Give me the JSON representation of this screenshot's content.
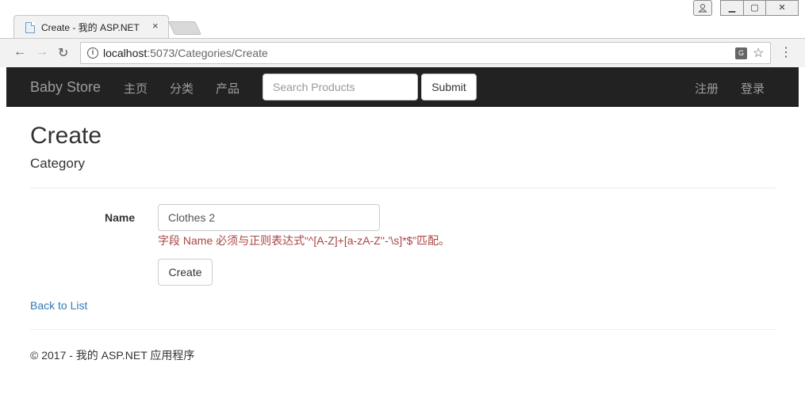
{
  "browser": {
    "tab_title": "Create - 我的 ASP.NET",
    "tab_close": "×",
    "url_host": "localhost",
    "url_path": ":5073/Categories/Create",
    "window_user_icon": "user-icon",
    "window_controls": {
      "minimize": "▁",
      "maximize": "▢",
      "close": "✕"
    }
  },
  "navbar": {
    "brand": "Baby Store",
    "links": [
      "主页",
      "分类",
      "产品"
    ],
    "search_placeholder": "Search Products",
    "submit_label": "Submit",
    "right_links": [
      "注册",
      "登录"
    ]
  },
  "page": {
    "title": "Create",
    "subtitle": "Category",
    "form": {
      "name_label": "Name",
      "name_value": "Clothes 2",
      "validation_message": "字段 Name 必须与正则表达式“^[A-Z]+[a-zA-Z''-'\\s]*$”匹配。",
      "create_label": "Create"
    },
    "back_link": "Back to List",
    "footer": "© 2017 - 我的 ASP.NET 应用程序"
  },
  "colors": {
    "navbar_bg": "#222222",
    "navbar_text": "#9d9d9d",
    "link": "#337ab7",
    "error": "#a94442"
  }
}
